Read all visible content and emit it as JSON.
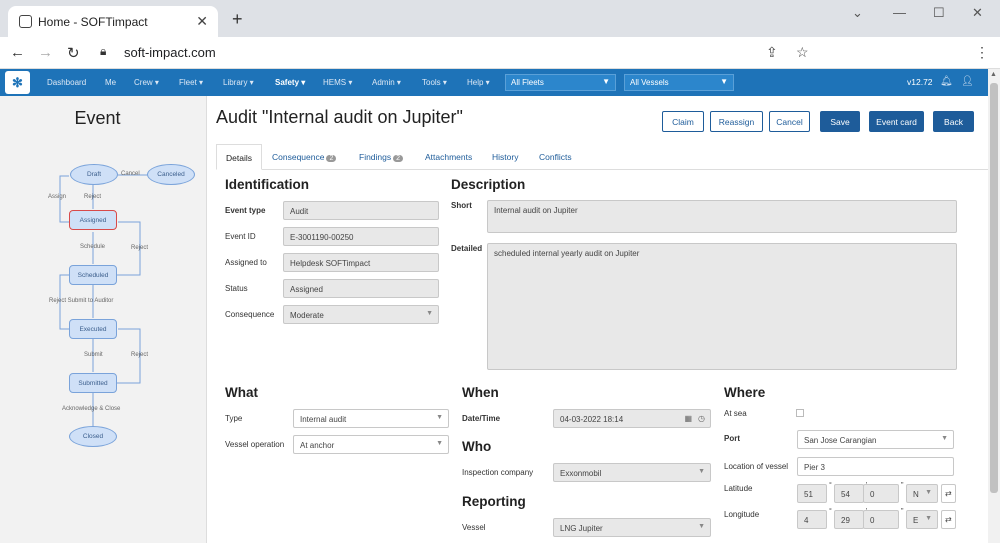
{
  "browser": {
    "tab_title": "Home - SOFTimpact",
    "url": "soft-impact.com"
  },
  "nav": {
    "items": [
      "Dashboard",
      "Me",
      "Crew ▾",
      "Fleet ▾",
      "Library ▾",
      "Safety ▾",
      "HEMS ▾",
      "Admin ▾",
      "Tools ▾",
      "Help ▾"
    ],
    "fleet": "All Fleets",
    "vessels": "All Vessels",
    "version": "v12.72"
  },
  "sidebar": {
    "title": "Event",
    "flow": {
      "draft": "Draft",
      "cancel": "Cancel",
      "canceled": "Canceled",
      "assign": "Assign",
      "reject1": "Reject",
      "assigned": "Assigned",
      "schedule": "Schedule",
      "reject2": "Reject",
      "scheduled": "Scheduled",
      "reject_submit": "Reject Submit to Auditor",
      "executed": "Executed",
      "submit": "Submit",
      "reject3": "Reject",
      "submitted": "Submitted",
      "ack": "Acknowledge & Close",
      "closed": "Closed"
    }
  },
  "page": {
    "title": "Audit \"Internal audit on Jupiter\"",
    "buttons": {
      "claim": "Claim",
      "reassign": "Reassign",
      "cancel": "Cancel",
      "save": "Save",
      "event_card": "Event card",
      "back": "Back"
    }
  },
  "tabs": {
    "details": "Details",
    "consequence": "Consequence",
    "consequence_count": "2",
    "findings": "Findings",
    "findings_count": "2",
    "attachments": "Attachments",
    "history": "History",
    "conflicts": "Conflicts"
  },
  "identification": {
    "heading": "Identification",
    "event_type_label": "Event type",
    "event_type": "Audit",
    "event_id_label": "Event ID",
    "event_id": "E-3001190-00250",
    "assigned_label": "Assigned to",
    "assigned": "Helpdesk SOFTimpact",
    "status_label": "Status",
    "status": "Assigned",
    "consequence_label": "Consequence",
    "consequence": "Moderate"
  },
  "description": {
    "heading": "Description",
    "short_label": "Short",
    "short": "Internal audit on Jupiter",
    "detailed_label": "Detailed",
    "detailed": "scheduled internal yearly audit on Jupiter"
  },
  "what": {
    "heading": "What",
    "type_label": "Type",
    "type": "Internal audit",
    "vessel_op_label": "Vessel operation",
    "vessel_op": "At anchor"
  },
  "when": {
    "heading": "When",
    "date_label": "Date/Time",
    "date": "04-03-2022 18:14"
  },
  "who": {
    "heading": "Who",
    "company_label": "Inspection company",
    "company": "Exxonmobil"
  },
  "reporting": {
    "heading": "Reporting",
    "vessel_label": "Vessel",
    "vessel": "LNG Jupiter"
  },
  "where": {
    "heading": "Where",
    "at_sea_label": "At sea",
    "port_label": "Port",
    "port": "San Jose Carangian",
    "location_label": "Location of vessel",
    "location": "Pier 3",
    "lat_label": "Latitude",
    "lat_deg": "51",
    "lat_min": "54",
    "lat_sec": "0",
    "lat_dir": "N",
    "lon_label": "Longitude",
    "lon_deg": "4",
    "lon_min": "29",
    "lon_sec": "0",
    "lon_dir": "E"
  }
}
